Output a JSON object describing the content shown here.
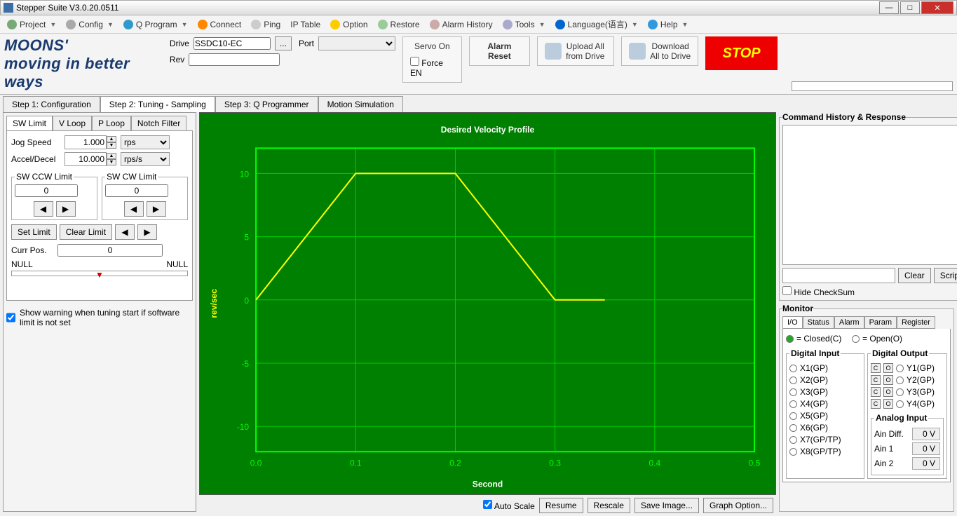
{
  "window": {
    "title": "Stepper Suite V3.0.20.0511"
  },
  "menu": {
    "project": "Project",
    "config": "Config",
    "qprogram": "Q Program",
    "connect": "Connect",
    "ping": "Ping",
    "iptable": "IP Table",
    "option": "Option",
    "restore": "Restore",
    "alarmhist": "Alarm History",
    "tools": "Tools",
    "language": "Language(语言)",
    "help": "Help"
  },
  "top": {
    "logo": "MOONS'",
    "logo_sub": "moving in better ways",
    "drive_label": "Drive",
    "drive_value": "SSDC10-EC",
    "rev_label": "Rev",
    "rev_value": "",
    "port_label": "Port",
    "port_value": "",
    "force_en": "Force EN",
    "servo_on": "Servo On",
    "alarm_reset": "Alarm Reset",
    "upload_l1": "Upload All",
    "upload_l2": "from Drive",
    "download_l1": "Download",
    "download_l2": "All to Drive",
    "stop": "STOP"
  },
  "steps": {
    "s1": "Step 1: Configuration",
    "s2": "Step 2: Tuning - Sampling",
    "s3": "Step 3: Q Programmer",
    "s4": "Motion Simulation"
  },
  "tuning": {
    "tabs": {
      "swlimit": "SW Limit",
      "vloop": "V Loop",
      "ploop": "P Loop",
      "notch": "Notch Filter"
    },
    "jog_label": "Jog Speed",
    "jog_val": "1.000",
    "jog_unit": "rps",
    "accel_label": "Accel/Decel",
    "accel_val": "10.000",
    "accel_unit": "rps/s",
    "ccw_legend": "SW CCW Limit",
    "ccw_val": "0",
    "cw_legend": "SW CW Limit",
    "cw_val": "0",
    "set_limit": "Set Limit",
    "clear_limit": "Clear Limit",
    "curr_pos_label": "Curr Pos.",
    "curr_pos_val": "0",
    "null_l": "NULL",
    "null_r": "NULL",
    "warn": "Show warning when tuning start if software limit is not set"
  },
  "chart_data": {
    "type": "line",
    "title": "Desired Velocity Profile",
    "xlabel": "Second",
    "ylabel": "rev/sec",
    "x": [
      0.0,
      0.1,
      0.2,
      0.3,
      0.35
    ],
    "y": [
      0,
      10,
      10,
      0,
      0
    ],
    "xticks": [
      0.0,
      0.1,
      0.2,
      0.3,
      0.4,
      0.5
    ],
    "yticks": [
      -10,
      -5,
      0,
      5,
      10
    ],
    "xlim": [
      0.0,
      0.5
    ],
    "ylim": [
      -12,
      12
    ]
  },
  "chartctl": {
    "autoscale": "Auto Scale",
    "resume": "Resume",
    "rescale": "Rescale",
    "saveimg": "Save Image...",
    "graphopt": "Graph Option..."
  },
  "history": {
    "legend": "Command History & Response",
    "clear": "Clear",
    "script": "Script",
    "hide_checksum": "Hide CheckSum"
  },
  "monitor": {
    "legend": "Monitor",
    "tabs": {
      "io": "I/O",
      "status": "Status",
      "alarm": "Alarm",
      "param": "Param",
      "register": "Register"
    },
    "closed": "= Closed(C)",
    "open": "= Open(O)",
    "di_legend": "Digital Input",
    "di": [
      "X1(GP)",
      "X2(GP)",
      "X3(GP)",
      "X4(GP)",
      "X5(GP)",
      "X6(GP)",
      "X7(GP/TP)",
      "X8(GP/TP)"
    ],
    "do_legend": "Digital Output",
    "do": [
      "Y1(GP)",
      "Y2(GP)",
      "Y3(GP)",
      "Y4(GP)"
    ],
    "ai_legend": "Analog Input",
    "ai": [
      {
        "label": "Ain Diff.",
        "val": "0 V"
      },
      {
        "label": "Ain 1",
        "val": "0 V"
      },
      {
        "label": "Ain 2",
        "val": "0 V"
      }
    ]
  }
}
